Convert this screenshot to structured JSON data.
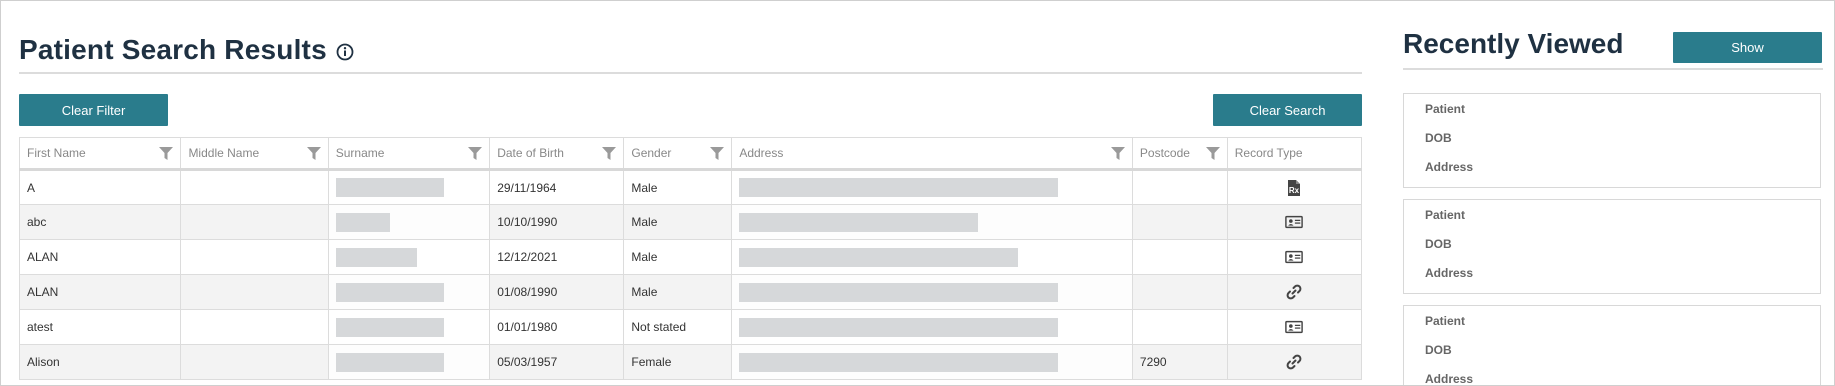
{
  "header": {
    "title": "Patient Search Results"
  },
  "toolbar": {
    "clear_filter_label": "Clear Filter",
    "clear_search_label": "Clear Search"
  },
  "table": {
    "columns": [
      "First Name",
      "Middle Name",
      "Surname",
      "Date of Birth",
      "Gender",
      "Address",
      "Postcode",
      "Record Type"
    ],
    "rows": [
      {
        "first_name": "A",
        "middle_name": "",
        "surname": "",
        "dob": "29/11/1964",
        "gender": "Male",
        "address": "",
        "postcode": "",
        "record_type": "prescription-icon"
      },
      {
        "first_name": "abc",
        "middle_name": "",
        "surname": "",
        "dob": "10/10/1990",
        "gender": "Male",
        "address": "",
        "postcode": "",
        "record_type": "id-card-icon"
      },
      {
        "first_name": "ALAN",
        "middle_name": "",
        "surname": "",
        "dob": "12/12/2021",
        "gender": "Male",
        "address": "",
        "postcode": "",
        "record_type": "id-card-icon"
      },
      {
        "first_name": "ALAN",
        "middle_name": "",
        "surname": "",
        "dob": "01/08/1990",
        "gender": "Male",
        "address": "",
        "postcode": "",
        "record_type": "link-icon"
      },
      {
        "first_name": "atest",
        "middle_name": "",
        "surname": "",
        "dob": "01/01/1980",
        "gender": "Not stated",
        "address": "",
        "postcode": "",
        "record_type": "id-card-icon"
      },
      {
        "first_name": "Alison",
        "middle_name": "",
        "surname": "",
        "dob": "05/03/1957",
        "gender": "Female",
        "address": "",
        "postcode": "7290",
        "record_type": "link-icon"
      }
    ]
  },
  "recently_viewed": {
    "title": "Recently Viewed",
    "show_label": "Show",
    "cards": [
      {
        "patient_label": "Patient",
        "dob_label": "DOB",
        "address_label": "Address"
      },
      {
        "patient_label": "Patient",
        "dob_label": "DOB",
        "address_label": "Address"
      },
      {
        "patient_label": "Patient",
        "dob_label": "DOB",
        "address_label": "Address"
      }
    ]
  },
  "colors": {
    "accent": "#2a7c8c",
    "heading": "#1f3142",
    "redaction": "#d6d8da"
  }
}
